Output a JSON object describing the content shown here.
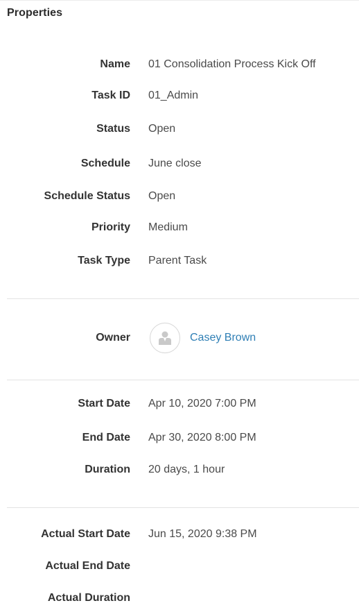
{
  "panel": {
    "title": "Properties"
  },
  "general": {
    "name_label": "Name",
    "name_value": "01 Consolidation Process Kick Off",
    "task_id_label": "Task ID",
    "task_id_value": "01_Admin",
    "status_label": "Status",
    "status_value": "Open",
    "schedule_label": "Schedule",
    "schedule_value": "June close",
    "schedule_status_label": "Schedule Status",
    "schedule_status_value": "Open",
    "priority_label": "Priority",
    "priority_value": "Medium",
    "task_type_label": "Task Type",
    "task_type_value": "Parent Task"
  },
  "owner": {
    "label": "Owner",
    "name": "Casey Brown",
    "avatar_icon": "user-avatar-icon",
    "link_color": "#2f7fb5"
  },
  "dates": {
    "start_label": "Start Date",
    "start_value": "Apr 10, 2020 7:00 PM",
    "end_label": "End Date",
    "end_value": "Apr 30, 2020 8:00 PM",
    "duration_label": "Duration",
    "duration_value": "20 days, 1 hour"
  },
  "actuals": {
    "actual_start_label": "Actual Start Date",
    "actual_start_value": "Jun 15, 2020 9:38 PM",
    "actual_end_label": "Actual End Date",
    "actual_end_value": "",
    "actual_duration_label": "Actual Duration",
    "actual_duration_value": ""
  }
}
